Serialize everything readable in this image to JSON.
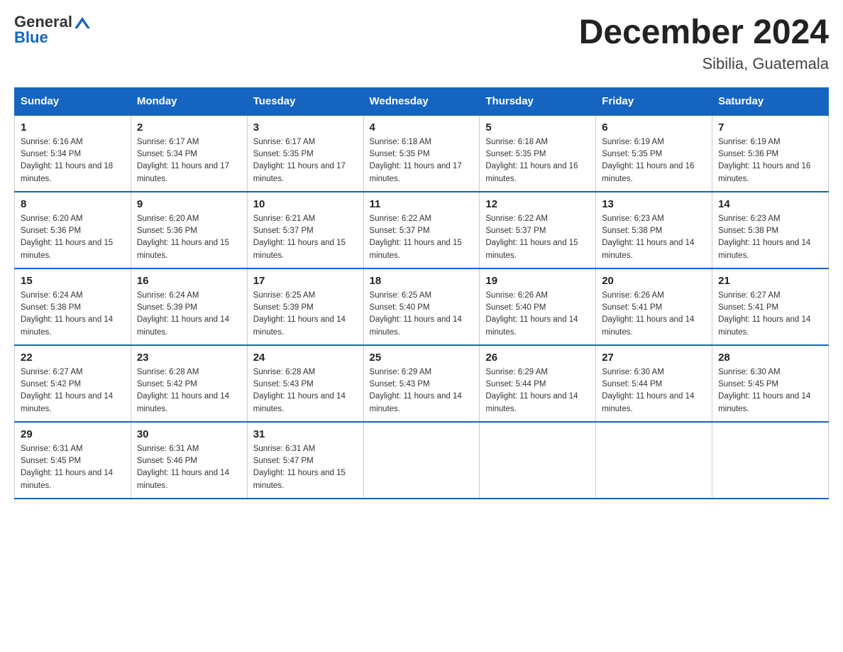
{
  "header": {
    "logo_text_general": "General",
    "logo_text_blue": "Blue",
    "month_title": "December 2024",
    "location": "Sibilia, Guatemala"
  },
  "days_of_week": [
    "Sunday",
    "Monday",
    "Tuesday",
    "Wednesday",
    "Thursday",
    "Friday",
    "Saturday"
  ],
  "weeks": [
    [
      {
        "day": "1",
        "sunrise": "6:16 AM",
        "sunset": "5:34 PM",
        "daylight": "11 hours and 18 minutes."
      },
      {
        "day": "2",
        "sunrise": "6:17 AM",
        "sunset": "5:34 PM",
        "daylight": "11 hours and 17 minutes."
      },
      {
        "day": "3",
        "sunrise": "6:17 AM",
        "sunset": "5:35 PM",
        "daylight": "11 hours and 17 minutes."
      },
      {
        "day": "4",
        "sunrise": "6:18 AM",
        "sunset": "5:35 PM",
        "daylight": "11 hours and 17 minutes."
      },
      {
        "day": "5",
        "sunrise": "6:18 AM",
        "sunset": "5:35 PM",
        "daylight": "11 hours and 16 minutes."
      },
      {
        "day": "6",
        "sunrise": "6:19 AM",
        "sunset": "5:35 PM",
        "daylight": "11 hours and 16 minutes."
      },
      {
        "day": "7",
        "sunrise": "6:19 AM",
        "sunset": "5:36 PM",
        "daylight": "11 hours and 16 minutes."
      }
    ],
    [
      {
        "day": "8",
        "sunrise": "6:20 AM",
        "sunset": "5:36 PM",
        "daylight": "11 hours and 15 minutes."
      },
      {
        "day": "9",
        "sunrise": "6:20 AM",
        "sunset": "5:36 PM",
        "daylight": "11 hours and 15 minutes."
      },
      {
        "day": "10",
        "sunrise": "6:21 AM",
        "sunset": "5:37 PM",
        "daylight": "11 hours and 15 minutes."
      },
      {
        "day": "11",
        "sunrise": "6:22 AM",
        "sunset": "5:37 PM",
        "daylight": "11 hours and 15 minutes."
      },
      {
        "day": "12",
        "sunrise": "6:22 AM",
        "sunset": "5:37 PM",
        "daylight": "11 hours and 15 minutes."
      },
      {
        "day": "13",
        "sunrise": "6:23 AM",
        "sunset": "5:38 PM",
        "daylight": "11 hours and 14 minutes."
      },
      {
        "day": "14",
        "sunrise": "6:23 AM",
        "sunset": "5:38 PM",
        "daylight": "11 hours and 14 minutes."
      }
    ],
    [
      {
        "day": "15",
        "sunrise": "6:24 AM",
        "sunset": "5:38 PM",
        "daylight": "11 hours and 14 minutes."
      },
      {
        "day": "16",
        "sunrise": "6:24 AM",
        "sunset": "5:39 PM",
        "daylight": "11 hours and 14 minutes."
      },
      {
        "day": "17",
        "sunrise": "6:25 AM",
        "sunset": "5:39 PM",
        "daylight": "11 hours and 14 minutes."
      },
      {
        "day": "18",
        "sunrise": "6:25 AM",
        "sunset": "5:40 PM",
        "daylight": "11 hours and 14 minutes."
      },
      {
        "day": "19",
        "sunrise": "6:26 AM",
        "sunset": "5:40 PM",
        "daylight": "11 hours and 14 minutes."
      },
      {
        "day": "20",
        "sunrise": "6:26 AM",
        "sunset": "5:41 PM",
        "daylight": "11 hours and 14 minutes."
      },
      {
        "day": "21",
        "sunrise": "6:27 AM",
        "sunset": "5:41 PM",
        "daylight": "11 hours and 14 minutes."
      }
    ],
    [
      {
        "day": "22",
        "sunrise": "6:27 AM",
        "sunset": "5:42 PM",
        "daylight": "11 hours and 14 minutes."
      },
      {
        "day": "23",
        "sunrise": "6:28 AM",
        "sunset": "5:42 PM",
        "daylight": "11 hours and 14 minutes."
      },
      {
        "day": "24",
        "sunrise": "6:28 AM",
        "sunset": "5:43 PM",
        "daylight": "11 hours and 14 minutes."
      },
      {
        "day": "25",
        "sunrise": "6:29 AM",
        "sunset": "5:43 PM",
        "daylight": "11 hours and 14 minutes."
      },
      {
        "day": "26",
        "sunrise": "6:29 AM",
        "sunset": "5:44 PM",
        "daylight": "11 hours and 14 minutes."
      },
      {
        "day": "27",
        "sunrise": "6:30 AM",
        "sunset": "5:44 PM",
        "daylight": "11 hours and 14 minutes."
      },
      {
        "day": "28",
        "sunrise": "6:30 AM",
        "sunset": "5:45 PM",
        "daylight": "11 hours and 14 minutes."
      }
    ],
    [
      {
        "day": "29",
        "sunrise": "6:31 AM",
        "sunset": "5:45 PM",
        "daylight": "11 hours and 14 minutes."
      },
      {
        "day": "30",
        "sunrise": "6:31 AM",
        "sunset": "5:46 PM",
        "daylight": "11 hours and 14 minutes."
      },
      {
        "day": "31",
        "sunrise": "6:31 AM",
        "sunset": "5:47 PM",
        "daylight": "11 hours and 15 minutes."
      },
      null,
      null,
      null,
      null
    ]
  ]
}
